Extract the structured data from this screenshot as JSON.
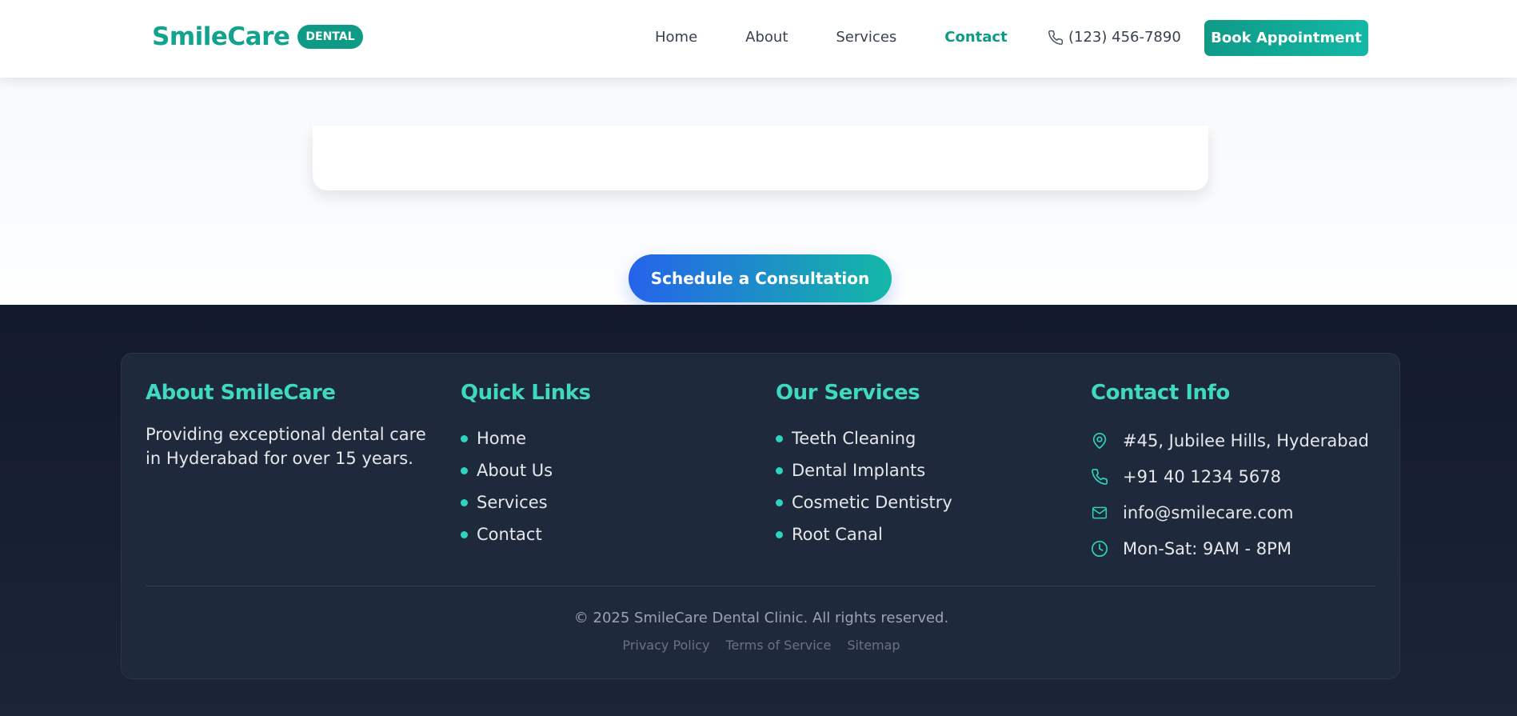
{
  "header": {
    "logo_text": "SmileCare",
    "logo_badge": "DENTAL",
    "nav": [
      {
        "label": "Home"
      },
      {
        "label": "About"
      },
      {
        "label": "Services"
      },
      {
        "label": "Contact",
        "active": true
      }
    ],
    "phone": "(123) 456-7890",
    "book_label": "Book Appointment"
  },
  "cta": {
    "label": "Schedule a Consultation"
  },
  "footer": {
    "about": {
      "title": "About SmileCare",
      "text": "Providing exceptional dental care in Hyderabad for over 15 years."
    },
    "quick_links": {
      "title": "Quick Links",
      "items": [
        "Home",
        "About Us",
        "Services",
        "Contact"
      ]
    },
    "services": {
      "title": "Our Services",
      "items": [
        "Teeth Cleaning",
        "Dental Implants",
        "Cosmetic Dentistry",
        "Root Canal"
      ]
    },
    "contact": {
      "title": "Contact Info",
      "address": "#45, Jubilee Hills, Hyderabad",
      "phone": "+91 40 1234 5678",
      "email": "info@smilecare.com",
      "hours": "Mon-Sat: 9AM - 8PM"
    },
    "copyright": "© 2025 SmileCare Dental Clinic. All rights reserved.",
    "legal": [
      "Privacy Policy",
      "Terms of Service",
      "Sitemap"
    ]
  },
  "colors": {
    "brand": "#0f9a86",
    "accent": "#2dd4bf",
    "cta_start": "#2563eb",
    "footer_bg": "#1e293b"
  }
}
